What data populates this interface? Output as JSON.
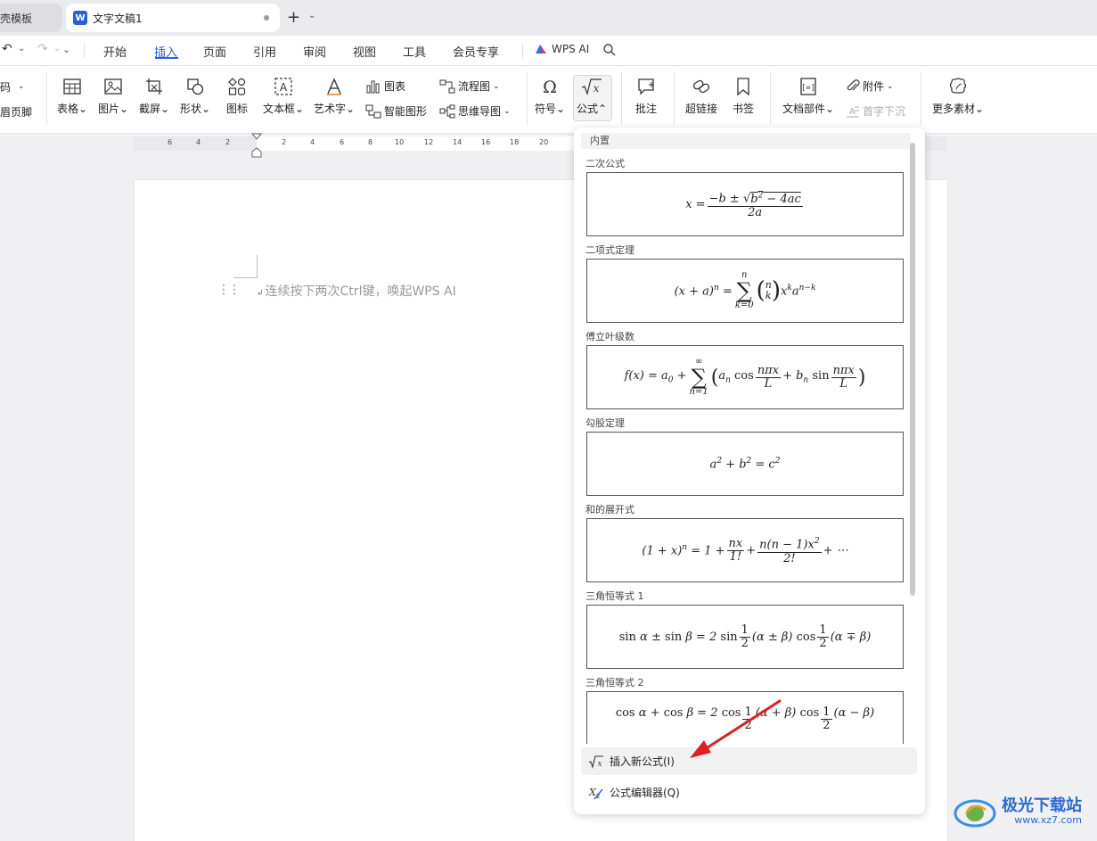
{
  "tabs": {
    "prev": "壳模板",
    "current": "文字文稿1",
    "new_tab": "+",
    "new_tab_menu": "⌄"
  },
  "quick": {
    "undo": "↶",
    "undo_dd": "⌄",
    "redo": "↷",
    "redo_dd": "⌄",
    "more": "⌄"
  },
  "menu": [
    "开始",
    "插入",
    "页面",
    "引用",
    "审阅",
    "视图",
    "工具",
    "会员专享"
  ],
  "menu_ai": "WPS AI",
  "ribbon": {
    "left_partial_top": "码",
    "left_partial_bottom": "眉页脚",
    "table": "表格",
    "picture": "图片",
    "screenshot": "截屏",
    "shape": "形状",
    "icon": "图标",
    "textbox": "文本框",
    "wordart": "艺术字",
    "chart": "图表",
    "smartart": "智能图形",
    "flowchart": "流程图",
    "mindmap": "思维导图",
    "symbol": "符号",
    "formula": "公式",
    "comment": "批注",
    "hyperlink": "超链接",
    "bookmark": "书签",
    "docparts": "文档部件",
    "attachment": "附件",
    "dropcap": "首字下沉",
    "more_material": "更多素材"
  },
  "ruler_numbers": [
    "6",
    "4",
    "2",
    "2",
    "4",
    "6",
    "8",
    "10",
    "12",
    "14",
    "16",
    "18",
    "20"
  ],
  "document": {
    "placeholder": "连续按下两次Ctrl键，唤起WPS AI",
    "para_mark": "↲"
  },
  "dropdown": {
    "header": "内置",
    "items": [
      {
        "name": "二次公式"
      },
      {
        "name": "二项式定理"
      },
      {
        "name": "傅立叶级数"
      },
      {
        "name": "勾股定理"
      },
      {
        "name": "和的展开式"
      },
      {
        "name": "三角恒等式 1"
      },
      {
        "name": "三角恒等式 2"
      }
    ],
    "insert_new": "插入新公式(I)",
    "editor": "公式编辑器(Q)"
  },
  "watermark": {
    "text": "极光下载站",
    "url": "www.xz7.com"
  }
}
